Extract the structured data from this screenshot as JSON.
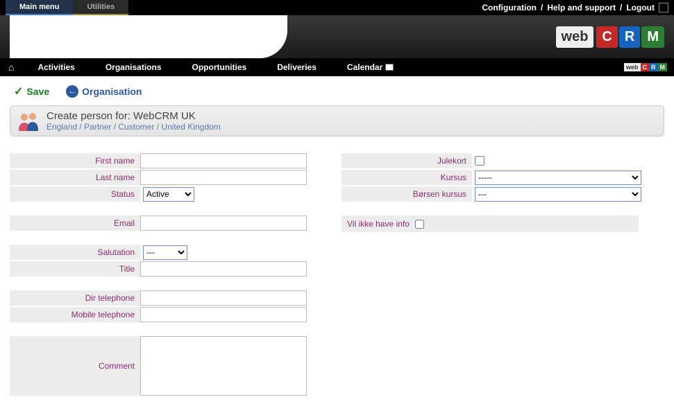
{
  "topbar": {
    "main_menu": "Main menu",
    "utilities": "Utilities",
    "configuration": "Configuration",
    "help": "Help and support",
    "logout": "Logout"
  },
  "logo": {
    "web": "web",
    "c": "C",
    "r": "R",
    "m": "M"
  },
  "nav": {
    "activities": "Activities",
    "organisations": "Organisations",
    "opportunities": "Opportunities",
    "deliveries": "Deliveries",
    "calendar": "Calendar"
  },
  "actions": {
    "save": "Save",
    "organisation": "Organisation"
  },
  "header": {
    "title": "Create person for: WebCRM UK",
    "breadcrumb": "England / Partner / Customer / United Kingdom"
  },
  "labels": {
    "first_name": "First name",
    "last_name": "Last name",
    "status": "Status",
    "email": "Email",
    "salutation": "Salutation",
    "title": "Title",
    "dir_tel": "Dir telephone",
    "mob_tel": "Mobile telephone",
    "comment": "Comment",
    "julekort": "Julekort",
    "kursus": "Kursus",
    "borsen": "Børsen kursus",
    "vil_ikke": "Vil ikke have info"
  },
  "values": {
    "first_name": "",
    "last_name": "",
    "status": "Active",
    "email": "",
    "salutation": "---",
    "title": "",
    "dir_tel": "",
    "mob_tel": "",
    "comment": "",
    "julekort": false,
    "kursus": "-----",
    "borsen": "---",
    "vil_ikke": false
  }
}
